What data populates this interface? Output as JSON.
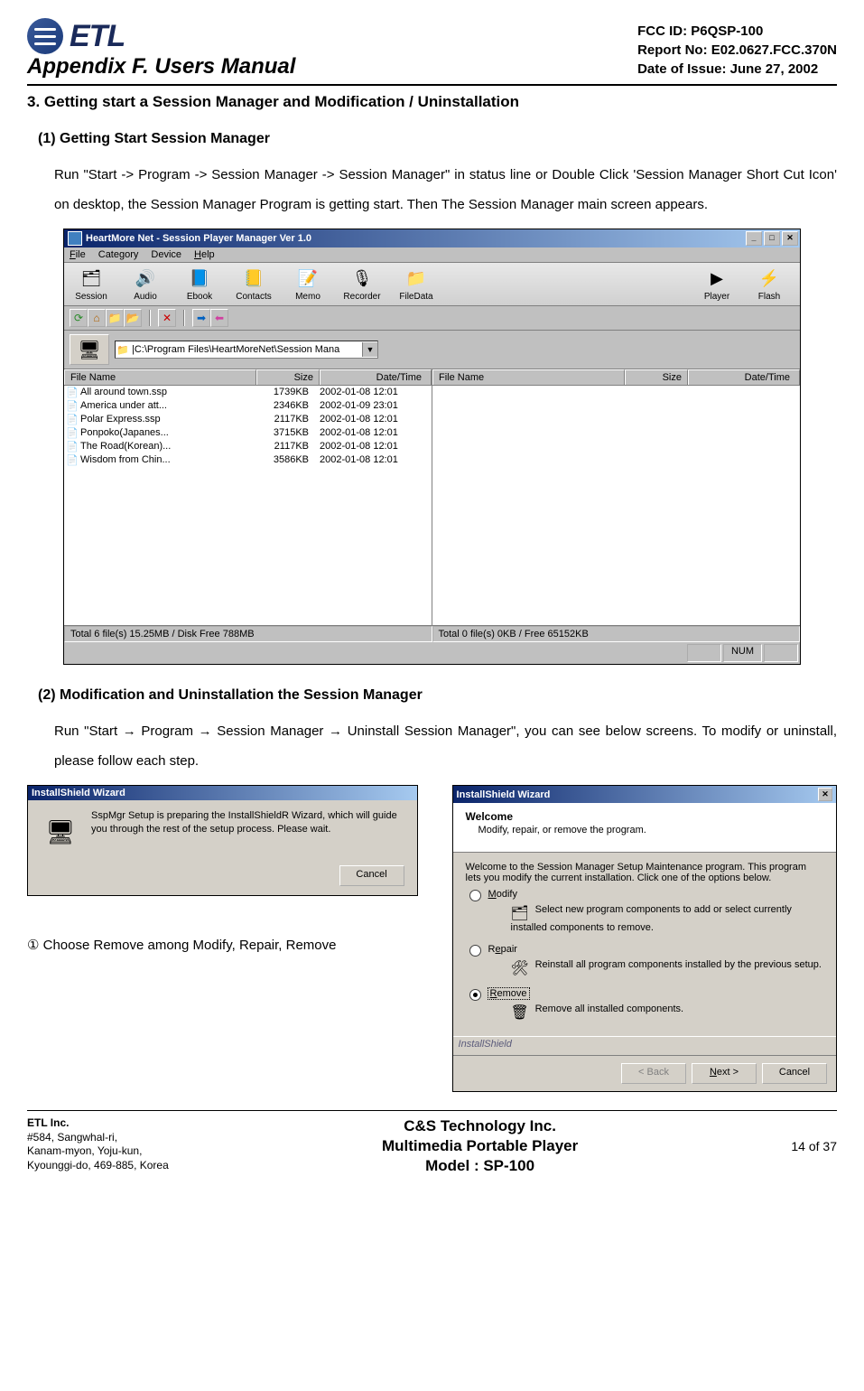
{
  "header": {
    "logo_text": "ETL",
    "appendix_title": "Appendix F.  Users Manual",
    "fcc_id": "FCC ID: P6QSP-100",
    "report_no": "Report No: E02.0627.FCC.370N",
    "issue_date": "Date of Issue: June 27, 2002"
  },
  "section_title": "3. Getting start a Session Manager and Modification / Uninstallation",
  "sub1_title": "(1) Getting Start Session Manager",
  "sub1_text": "Run \"Start -> Program -> Session Manager   -> Session Manager\" in status line or Double Click 'Session Manager Short Cut Icon' on desktop, the Session Manager Program is getting start. Then The Session Manager main screen appears.",
  "app": {
    "title": "HeartMore Net - Session Player Manager Ver 1.0",
    "menus": [
      "File",
      "Category",
      "Device",
      "Help"
    ],
    "big_tabs": [
      {
        "label": "Session",
        "glyph": "🗂"
      },
      {
        "label": "Audio",
        "glyph": "🔊"
      },
      {
        "label": "Ebook",
        "glyph": "📘"
      },
      {
        "label": "Contacts",
        "glyph": "📒"
      },
      {
        "label": "Memo",
        "glyph": "📝"
      },
      {
        "label": "Recorder",
        "glyph": "🎙"
      },
      {
        "label": "FileData",
        "glyph": "📁"
      }
    ],
    "right_tabs": [
      {
        "label": "Player",
        "glyph": "▶"
      },
      {
        "label": "Flash",
        "glyph": "⚡"
      }
    ],
    "sub_icons": [
      {
        "name": "refresh-icon",
        "glyph": "⟳",
        "color": "#2a8a2a"
      },
      {
        "name": "home-icon",
        "glyph": "⌂",
        "color": "#b06000"
      },
      {
        "name": "folder-icon",
        "glyph": "📁",
        "color": ""
      },
      {
        "name": "folder-open-icon",
        "glyph": "📂",
        "color": ""
      }
    ],
    "sub_icons2": [
      {
        "name": "delete-icon",
        "glyph": "✕",
        "color": "#cc0000"
      }
    ],
    "sub_icons3": [
      {
        "name": "arrow-right-icon",
        "glyph": "➡",
        "color": "#0060c0"
      },
      {
        "name": "arrow-left-icon",
        "glyph": "⬅",
        "color": "#d040a0"
      }
    ],
    "path": "|C:\\Program Files\\HeartMoreNet\\Session Mana",
    "headers": {
      "name": "File Name",
      "size": "Size",
      "date": "Date/Time"
    },
    "left_files": [
      {
        "name": "All around town.ssp",
        "size": "1739KB",
        "date": "2002-01-08 12:01"
      },
      {
        "name": "America under att...",
        "size": "2346KB",
        "date": "2002-01-09 23:01"
      },
      {
        "name": "Polar Express.ssp",
        "size": "2117KB",
        "date": "2002-01-08 12:01"
      },
      {
        "name": "Ponpoko(Japanes...",
        "size": "3715KB",
        "date": "2002-01-08 12:01"
      },
      {
        "name": "The Road(Korean)...",
        "size": "2117KB",
        "date": "2002-01-08 12:01"
      },
      {
        "name": "Wisdom from Chin...",
        "size": "3586KB",
        "date": "2002-01-08 12:01"
      }
    ],
    "status_left": "Total 6 file(s) 15.25MB / Disk Free 788MB",
    "status_right": "Total 0 file(s) 0KB / Free 65152KB",
    "num_indicator": "NUM"
  },
  "sub2_title": "(2) Modification and Uninstallation the Session Manager",
  "sub2_text": "Run \"Start → Program → Session Manager  → Uninstall Session Manager\", you can see below screens.  To modify or uninstall, please follow each step.",
  "wizard1": {
    "title": "InstallShield Wizard",
    "msg": "SspMgr Setup is preparing the InstallShieldR Wizard, which will guide you through the rest of the setup process. Please wait.",
    "cancel": "Cancel"
  },
  "step_line": "① Choose Remove among Modify, Repair, Remove",
  "wizard2": {
    "title": "InstallShield Wizard",
    "welcome": "Welcome",
    "welcome_sub": "Modify, repair, or remove the program.",
    "intro": "Welcome to the Session Manager Setup Maintenance program. This program lets you modify the current installation. Click one of the options below.",
    "opt_modify": "Modify",
    "opt_modify_desc": "Select new program components to add or select currently installed components to remove.",
    "opt_repair": "Repair",
    "opt_repair_desc": "Reinstall all program components installed by the previous setup.",
    "opt_remove": "Remove",
    "opt_remove_desc": "Remove all installed components.",
    "brand": "InstallShield",
    "btn_back": "< Back",
    "btn_next": "Next >",
    "btn_cancel": "Cancel"
  },
  "footer": {
    "company": "ETL Inc.",
    "addr1": "#584, Sangwhal-ri,",
    "addr2": "Kanam-myon, Yoju-kun,",
    "addr3": "Kyounggi-do, 469-885, Korea",
    "center1": "C&S Technology Inc.",
    "center2": "Multimedia Portable Player",
    "center3": "Model : SP-100",
    "page": "14 of 37"
  }
}
